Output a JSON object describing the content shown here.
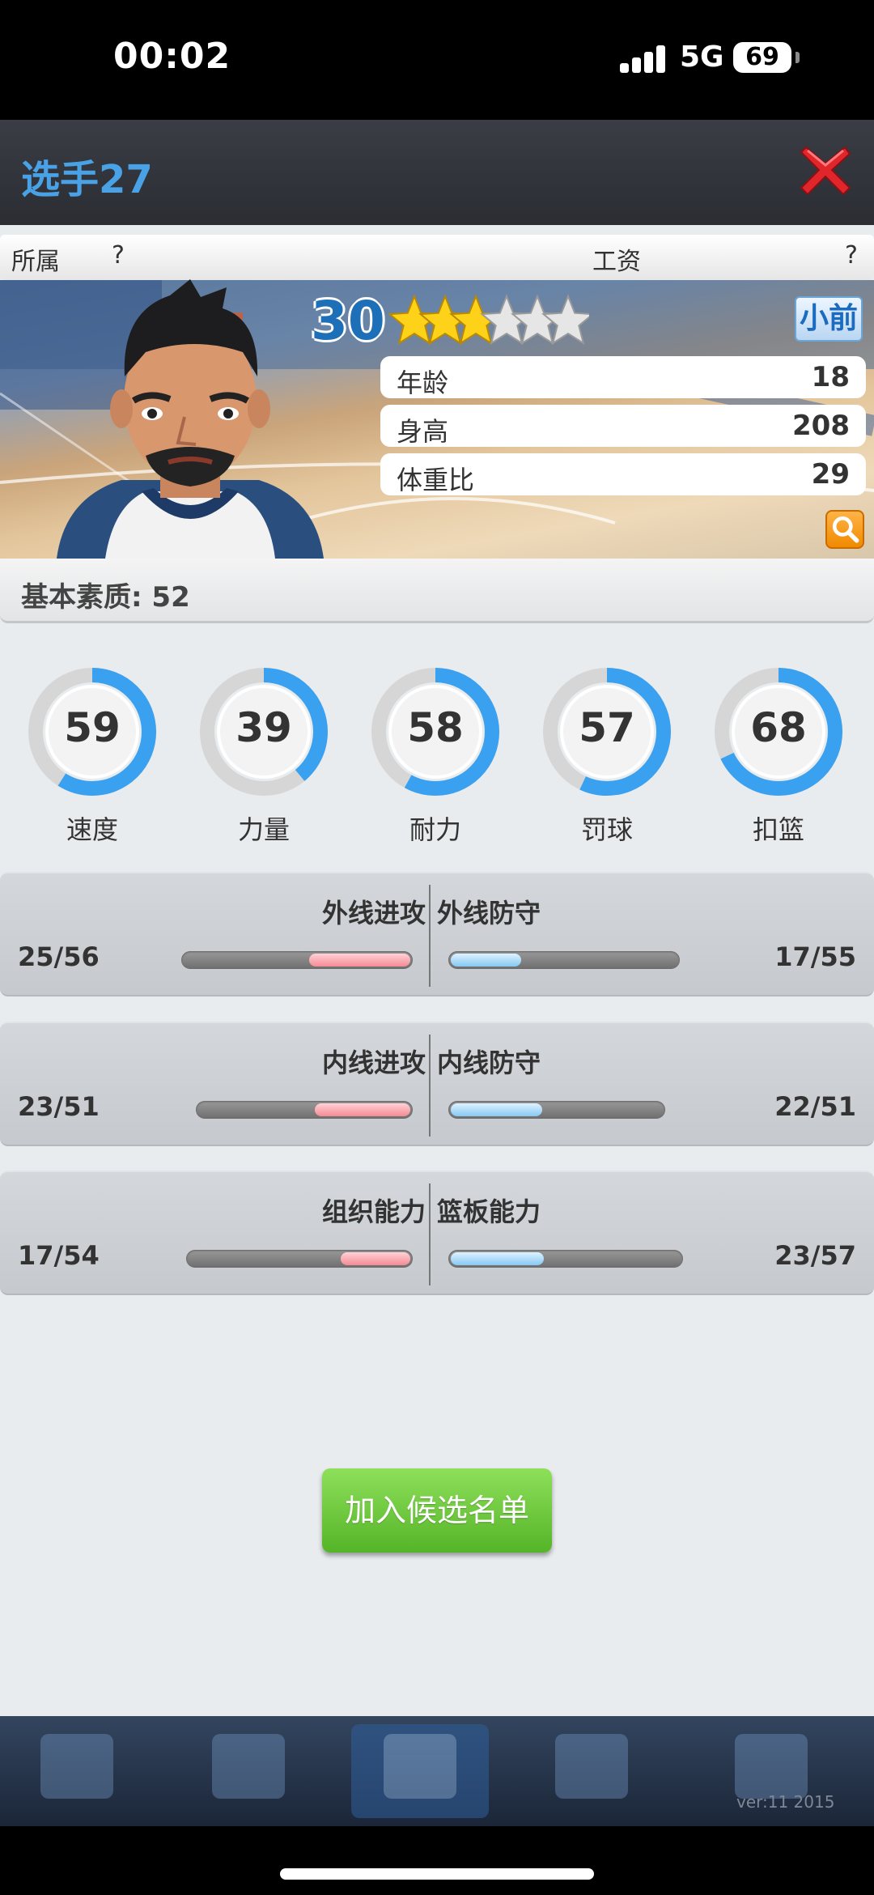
{
  "status_bar": {
    "time": "00:02",
    "network": "5G",
    "battery": "69"
  },
  "header": {
    "title": "选手27"
  },
  "info": {
    "team_label": "所属",
    "team_value": "?",
    "salary_label": "工资",
    "salary_value": "?"
  },
  "player": {
    "level": "30",
    "stars_filled": 3,
    "stars_total": 6,
    "position_badge": "小前",
    "attributes": [
      {
        "label": "年龄",
        "value": "18"
      },
      {
        "label": "身高",
        "value": "208"
      },
      {
        "label": "体重比",
        "value": "29"
      }
    ]
  },
  "basic": {
    "label": "基本素质: 52"
  },
  "gauges": [
    {
      "label": "速度",
      "value": 59
    },
    {
      "label": "力量",
      "value": 39
    },
    {
      "label": "耐力",
      "value": 58
    },
    {
      "label": "罚球",
      "value": 57
    },
    {
      "label": "扣篮",
      "value": 68
    }
  ],
  "skills": [
    {
      "left_name": "外线进攻",
      "left_value": "25/56",
      "right_name": "外线防守",
      "right_value": "17/55"
    },
    {
      "left_name": "内线进攻",
      "left_value": "23/51",
      "right_name": "内线防守",
      "right_value": "22/51"
    },
    {
      "left_name": "组织能力",
      "left_value": "17/54",
      "right_name": "篮板能力",
      "right_value": "23/57"
    }
  ],
  "actions": {
    "join_label": "加入候选名单"
  },
  "footer": {
    "version": "ver:11  2015"
  },
  "colors": {
    "accent_blue": "#4aa2e6",
    "gauge_blue": "#3aa0f0",
    "button_green": "#6ac83a",
    "close_red": "#e0262b"
  }
}
